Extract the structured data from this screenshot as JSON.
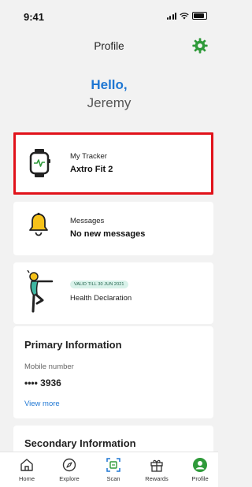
{
  "status_bar": {
    "time": "9:41"
  },
  "header": {
    "title": "Profile"
  },
  "greeting": {
    "hello": "Hello,",
    "name": "Jeremy"
  },
  "tracker_card": {
    "label": "My Tracker",
    "value": "Axtro Fit 2"
  },
  "messages_card": {
    "label": "Messages",
    "value": "No new messages"
  },
  "health_card": {
    "badge": "VALID TILL 30 JUN 2021",
    "label": "Health Declaration"
  },
  "primary_info": {
    "title": "Primary Information",
    "mobile_label": "Mobile number",
    "mobile_value": "•••• 3936",
    "view_more": "View more"
  },
  "secondary_info": {
    "title": "Secondary Information"
  },
  "nav": {
    "items": [
      {
        "label": "Home",
        "icon": "home-icon"
      },
      {
        "label": "Explore",
        "icon": "compass-icon"
      },
      {
        "label": "Scan",
        "icon": "scan-icon"
      },
      {
        "label": "Rewards",
        "icon": "gift-icon"
      },
      {
        "label": "Profile",
        "icon": "profile-icon"
      }
    ]
  },
  "colors": {
    "accent": "#1f77d3",
    "brand_green": "#2f9a3a",
    "highlight": "#e1121a"
  }
}
